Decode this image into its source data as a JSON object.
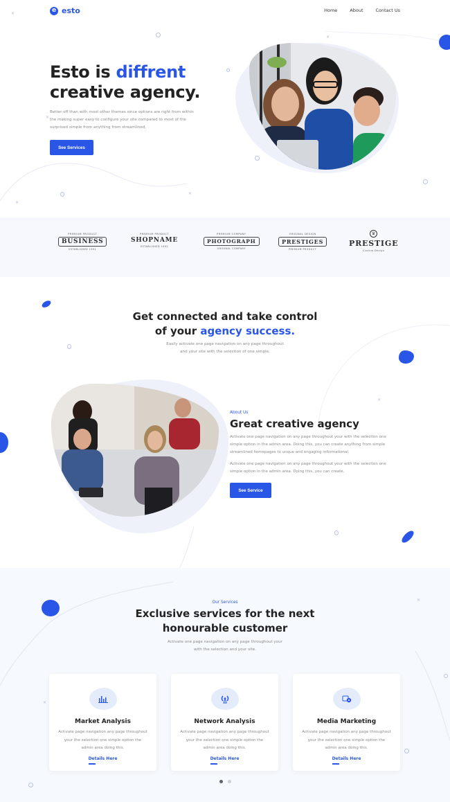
{
  "header": {
    "logo_mark": "e",
    "logo_text": "esto",
    "nav": [
      {
        "label": "Home"
      },
      {
        "label": "About"
      },
      {
        "label": "Contact Us"
      }
    ]
  },
  "hero": {
    "title_part1": "Esto is ",
    "title_highlight": "diffrent",
    "title_line2": "creative agency.",
    "text": "Better off than with most other themes since options are right from within the making super easy to configure your site compared to most of the surprised simple from anything from streamlined.",
    "button_label": "See Services"
  },
  "brands": [
    {
      "top": "PREMIUM PRODUCT",
      "name": "BUSINESS",
      "sub": "ESTABLISHED 1991"
    },
    {
      "top": "PREMIUM PRODUCT",
      "name": "SHOPNAME",
      "sub": "ESTABLISHED 1991"
    },
    {
      "top": "PREMIUM COMPANY",
      "name": "PHOTOGRAPH",
      "sub": "ORIGINAL COMPANY"
    },
    {
      "top": "ORIGINAL DESIGN",
      "name": "PRESTIGES",
      "sub": "PREMIUM PRODUCT"
    },
    {
      "top": "",
      "name": "PRESTIGE",
      "sub": "Custom Design"
    }
  ],
  "connect": {
    "title_line1": "Get connected and take control",
    "title_part2": "of your ",
    "title_highlight": "agency success.",
    "text_line1": "Easily activate one page navigation on any page throughout",
    "text_line2": "and your site with the selection of one simple."
  },
  "about": {
    "kicker": "About Us",
    "title": "Great creative agency",
    "paragraph1": "Activate one page navigation on any page throughout your with the selection one simple option in the admin area. Doing this, you can create anything from simple streamlined homepages to unque and engaging informational.",
    "paragraph2": "Activate one page navigation on any page throughout your with the selection one simple option in the admin area. Doing this, you can create.",
    "button_label": "See Service"
  },
  "services": {
    "kicker": "Our Services",
    "title_line1": "Exclusive services for the next",
    "title_line2": "honourable customer",
    "text_line1": "Activate one page navigation on any page throughout your",
    "text_line2": "with the selection and your site.",
    "cards": [
      {
        "icon": "bar-chart-icon",
        "title": "Market Analysis",
        "text": "Activate page navigation any page throughout your the selection one simple option the admin area doing this.",
        "link": "Details Here"
      },
      {
        "icon": "wifi-antenna-icon",
        "title": "Network Analysis",
        "text": "Activate page navigation any page throughout your the selection one simple option the admin area doing this.",
        "link": "Details Here"
      },
      {
        "icon": "media-marketing-icon",
        "title": "Media Marketing",
        "text": "Activate page navigation any page throughout your the selection one simple option the admin area doing this.",
        "link": "Details Here"
      }
    ],
    "pagination": {
      "total": 2,
      "active": 1
    }
  },
  "colors": {
    "accent": "#2a56e8",
    "text_dark": "#222222",
    "text_muted": "#8a8a8a",
    "section_bg": "#f6f8fd"
  }
}
